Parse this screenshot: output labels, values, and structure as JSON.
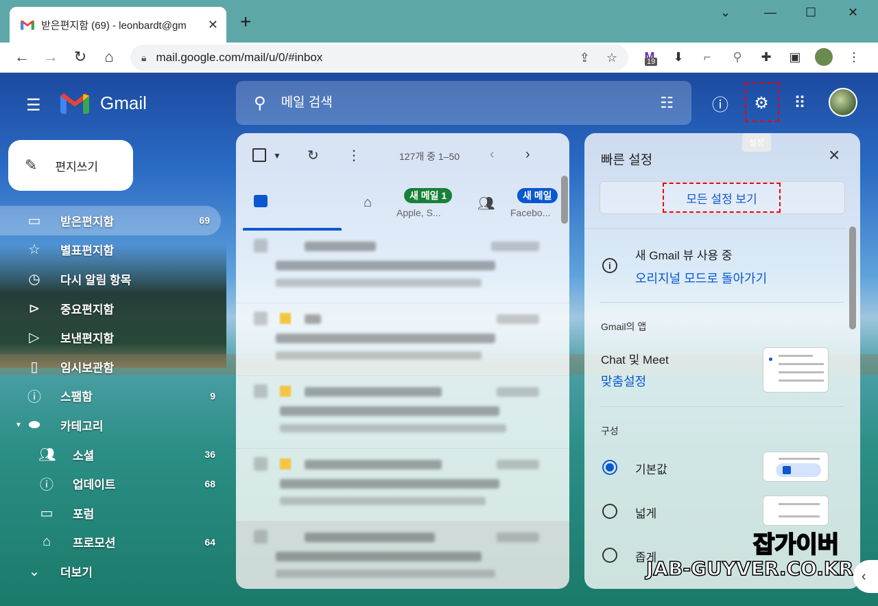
{
  "browser": {
    "tab_title": "받은편지함 (69) - leonbardt@gm",
    "url": "mail.google.com/mail/u/0/#inbox",
    "extension_badge": "19"
  },
  "gmail": {
    "logo_text": "Gmail",
    "search_placeholder": "메일 검색",
    "settings_tooltip": "설정"
  },
  "sidebar": {
    "compose_label": "편지쓰기",
    "items": [
      {
        "label": "받은편지함",
        "count": "69",
        "icon": "inbox-icon"
      },
      {
        "label": "별표편지함",
        "count": "",
        "icon": "star-icon"
      },
      {
        "label": "다시 알림 항목",
        "count": "",
        "icon": "clock-icon"
      },
      {
        "label": "중요편지함",
        "count": "",
        "icon": "important-icon"
      },
      {
        "label": "보낸편지함",
        "count": "",
        "icon": "send-icon"
      },
      {
        "label": "임시보관함",
        "count": "",
        "icon": "draft-icon"
      },
      {
        "label": "스팸함",
        "count": "9",
        "icon": "spam-icon"
      },
      {
        "label": "카테고리",
        "count": "",
        "icon": "label-icon"
      },
      {
        "label": "소셜",
        "count": "36",
        "icon": "people-icon"
      },
      {
        "label": "업데이트",
        "count": "68",
        "icon": "info-icon"
      },
      {
        "label": "포럼",
        "count": "",
        "icon": "forum-icon"
      },
      {
        "label": "프로모션",
        "count": "64",
        "icon": "tag-icon"
      },
      {
        "label": "더보기",
        "count": "",
        "icon": "chevron-down-icon"
      }
    ]
  },
  "mail_list": {
    "page_info": "127개 중 1–50",
    "tabs": [
      {
        "badge": "새 메일 1",
        "sub": "Apple, S..."
      },
      {
        "badge": "새 메일",
        "sub": "Facebo..."
      }
    ]
  },
  "quick_settings": {
    "title": "빠른 설정",
    "see_all": "모든 설정 보기",
    "new_view": "새 Gmail 뷰 사용 중",
    "revert_link": "오리지널 모드로 돌아가기",
    "apps_section": "Gmail의 앱",
    "chat_meet": "Chat 및 Meet",
    "customize_link": "맞춤설정",
    "density_section": "구성",
    "options": [
      "기본값",
      "넓게",
      "좁게"
    ]
  },
  "watermark": {
    "korean": "잡가이버",
    "english": "JAB-GUYVER.CO.KR"
  }
}
